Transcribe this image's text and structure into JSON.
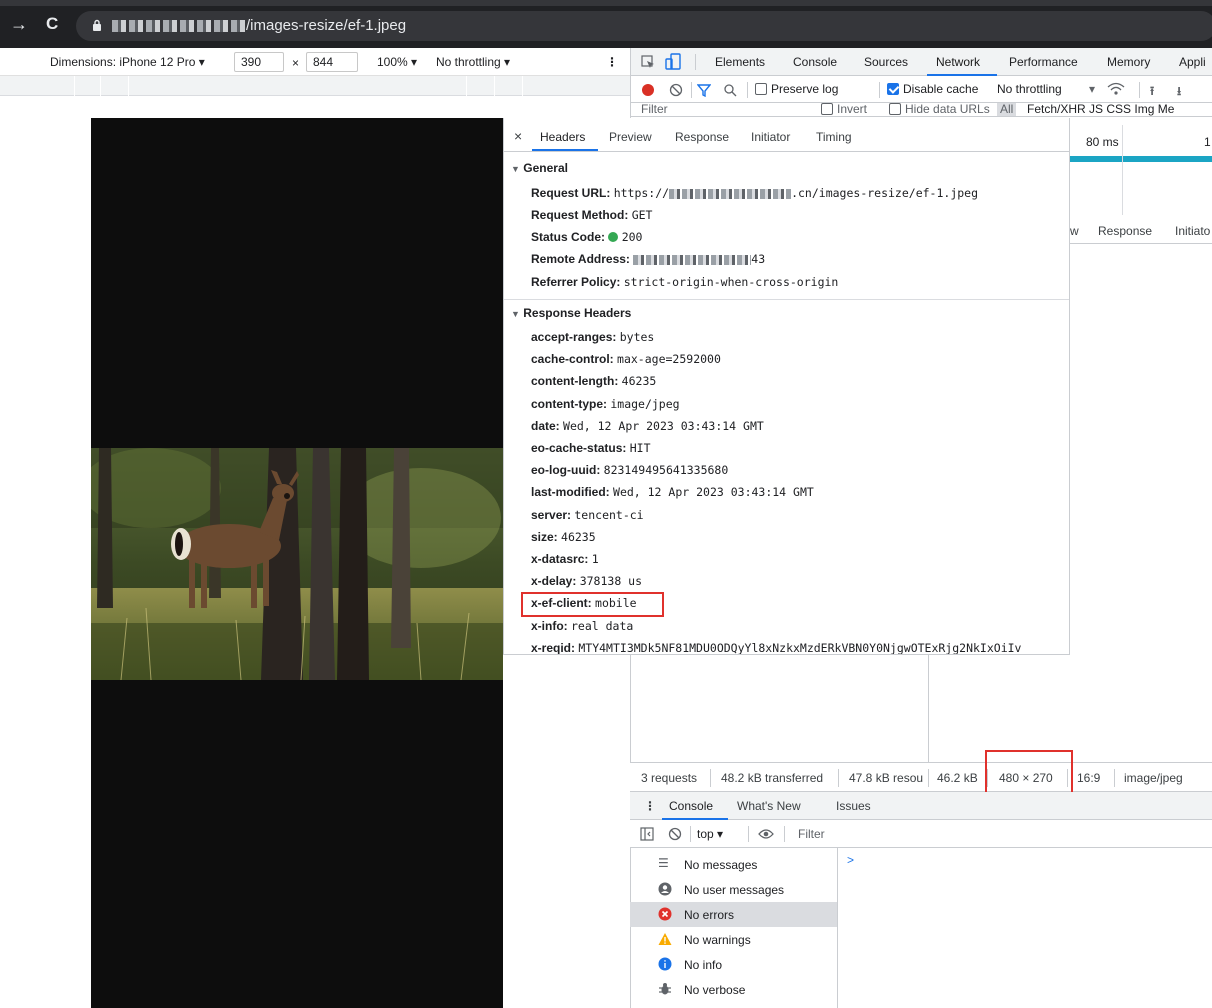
{
  "browser": {
    "url_visible": "/images-resize/ef-1.jpeg"
  },
  "device_toolbar": {
    "dimensions_label": "Dimensions: iPhone 12 Pro ▾",
    "width": "390",
    "times": "×",
    "height": "844",
    "zoom": "100% ▾",
    "throttling": "No throttling ▾"
  },
  "devtools": {
    "tabs": [
      "Elements",
      "Console",
      "Sources",
      "Network",
      "Performance",
      "Memory",
      "Appli"
    ],
    "active_tab": "Network",
    "network_toolbar": {
      "preserve_log": "Preserve log",
      "disable_cache": "Disable cache",
      "throttling": "No throttling"
    },
    "filter": {
      "placeholder": "Filter",
      "invert": "Invert",
      "hide_data_urls": "Hide data URLs",
      "all": "All",
      "types": "Fetch/XHR  JS  CSS  Img  Me"
    },
    "timeline_label": "80 ms",
    "timeline_label2": "1",
    "response_tabs": {
      "w": "w",
      "response": "Response",
      "initiator": "Initiato"
    },
    "headers_panel": {
      "close": "×",
      "tabs": [
        "Headers",
        "Preview",
        "Response",
        "Initiator",
        "Timing"
      ],
      "general_title": "General",
      "general": {
        "request_url_key": "Request URL:",
        "request_url_prefix": "https://",
        "request_url_suffix": ".cn/images-resize/ef-1.jpeg",
        "request_method_key": "Request Method:",
        "request_method": "GET",
        "status_code_key": "Status Code:",
        "status_code": "200",
        "remote_address_key": "Remote Address:",
        "remote_address_suffix": "43",
        "referrer_policy_key": "Referrer Policy:",
        "referrer_policy": "strict-origin-when-cross-origin"
      },
      "response_title": "Response Headers",
      "response_headers": [
        {
          "k": "accept-ranges:",
          "v": "bytes"
        },
        {
          "k": "cache-control:",
          "v": "max-age=2592000"
        },
        {
          "k": "content-length:",
          "v": "46235"
        },
        {
          "k": "content-type:",
          "v": "image/jpeg"
        },
        {
          "k": "date:",
          "v": "Wed, 12 Apr 2023 03:43:14 GMT"
        },
        {
          "k": "eo-cache-status:",
          "v": "HIT"
        },
        {
          "k": "eo-log-uuid:",
          "v": "823149495641335680"
        },
        {
          "k": "last-modified:",
          "v": "Wed, 12 Apr 2023 03:43:14 GMT"
        },
        {
          "k": "server:",
          "v": "tencent-ci"
        },
        {
          "k": "size:",
          "v": "46235"
        },
        {
          "k": "x-datasrc:",
          "v": "1"
        },
        {
          "k": "x-delay:",
          "v": "378138 us"
        },
        {
          "k": "x-ef-client:",
          "v": "mobile"
        },
        {
          "k": "x-info:",
          "v": "real data"
        },
        {
          "k": "x-reqid:",
          "v": "MTY4MTI3MDk5NF81MDU0ODQyYl8xNzkxMzdERkVBN0Y0NjgwOTExRjg2NkIxOiIv"
        }
      ]
    },
    "summary": {
      "requests": "3 requests",
      "transferred": "48.2 kB transferred",
      "resources": "47.8 kB resou",
      "size": "46.2 kB",
      "dimensions": "480 × 270",
      "ratio": "16:9",
      "mime": "image/jpeg"
    },
    "drawer": {
      "tabs": [
        "Console",
        "What's New",
        "Issues"
      ],
      "context": "top ▾",
      "filter_placeholder": "Filter",
      "prompt": ">",
      "sidebar": [
        {
          "label": "No messages",
          "icon": "list-icon"
        },
        {
          "label": "No user messages",
          "icon": "user-icon"
        },
        {
          "label": "No errors",
          "icon": "error-icon"
        },
        {
          "label": "No warnings",
          "icon": "warning-icon"
        },
        {
          "label": "No info",
          "icon": "info-icon"
        },
        {
          "label": "No verbose",
          "icon": "bug-icon"
        }
      ]
    }
  },
  "colors": {
    "accent": "#1a73e8",
    "highlight_box": "#e0312c",
    "status_ok": "#34a853"
  }
}
